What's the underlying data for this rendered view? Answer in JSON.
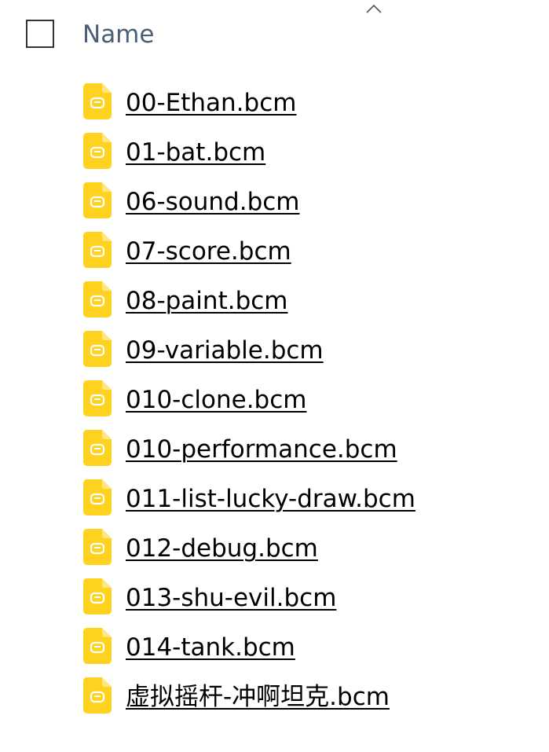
{
  "header": {
    "column_name": "Name",
    "sort_icon": "chevron-up-icon"
  },
  "file_icon": "file-icon",
  "colors": {
    "file_icon": "#FFD21F",
    "header_text": "#4a5e76",
    "file_text": "#000000"
  },
  "files": [
    {
      "name": "00-Ethan.bcm"
    },
    {
      "name": "01-bat.bcm"
    },
    {
      "name": "06-sound.bcm"
    },
    {
      "name": "07-score.bcm"
    },
    {
      "name": "08-paint.bcm"
    },
    {
      "name": "09-variable.bcm"
    },
    {
      "name": "010-clone.bcm"
    },
    {
      "name": "010-performance.bcm"
    },
    {
      "name": "011-list-lucky-draw.bcm"
    },
    {
      "name": "012-debug.bcm"
    },
    {
      "name": "013-shu-evil.bcm"
    },
    {
      "name": "014-tank.bcm"
    },
    {
      "name": "虚拟摇杆-冲啊坦克.bcm"
    }
  ]
}
